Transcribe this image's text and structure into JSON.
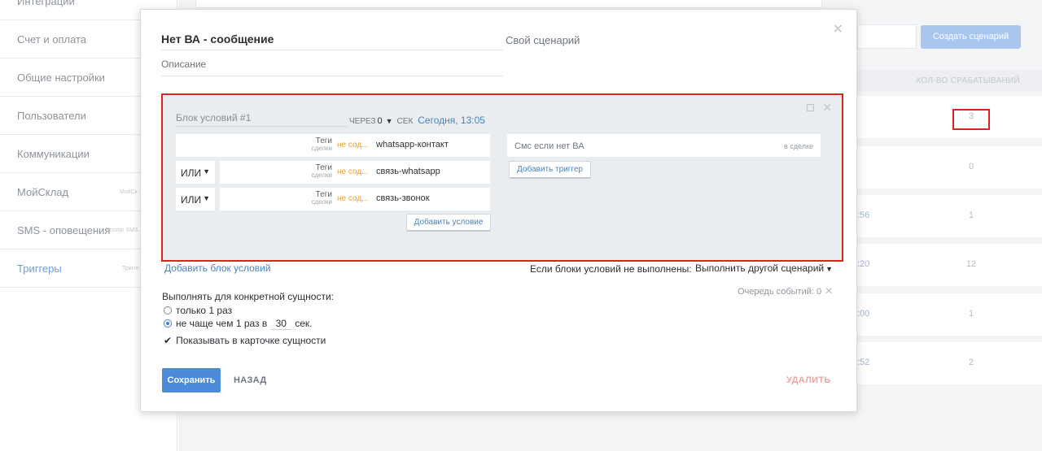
{
  "sidebar": {
    "items": [
      {
        "label": "Интеграции",
        "sub": ""
      },
      {
        "label": "Счет и оплата",
        "sub": ""
      },
      {
        "label": "Общие настройки",
        "sub": ""
      },
      {
        "label": "Пользователи",
        "sub": ""
      },
      {
        "label": "Коммуникации",
        "sub": ""
      },
      {
        "label": "МойСклад",
        "sub": "МойСк"
      },
      {
        "label": "SMS - оповещения",
        "sub": "Prostor SMS"
      },
      {
        "label": "Триггеры",
        "sub": "Тригге"
      }
    ]
  },
  "background": {
    "create_button": "Создать сценарий",
    "column_header": "КОЛ-ВО СРАБАТЫВАНИЙ",
    "rows": [
      {
        "time": "",
        "count": "3"
      },
      {
        "time": "",
        "count": "0"
      },
      {
        "time": ":56",
        "count": "1"
      },
      {
        "time": ":20",
        "count": "12"
      },
      {
        "time": ":00",
        "count": "1"
      },
      {
        "time": ":52",
        "count": "2"
      }
    ]
  },
  "modal": {
    "title": "Нет ВА - сообщение",
    "scenario_type": "Свой сценарий",
    "description_placeholder": "Описание",
    "block": {
      "title": "Блок условий #1",
      "via_label": "ЧЕРЕЗ",
      "via_value": "0",
      "sec_label": "СЕК",
      "date": "Сегодня, 13:05",
      "conditions": [
        {
          "connector": "",
          "field": "Теги",
          "field_sub": "сделки",
          "op": "не сод...",
          "value": "whatsapp-контакт"
        },
        {
          "connector": "ИЛИ",
          "field": "Теги",
          "field_sub": "сделки",
          "op": "не сод...",
          "value": "связь-whatsapp"
        },
        {
          "connector": "ИЛИ",
          "field": "Теги",
          "field_sub": "сделки",
          "op": "не сод...",
          "value": "связь-звонок"
        }
      ],
      "add_condition": "Добавить условие",
      "trigger": {
        "name": "Смс если нет ВА",
        "context": "в сделке"
      },
      "add_trigger": "Добавить триггер"
    },
    "add_block": "Добавить блок условий",
    "else_label": "Если блоки условий не выполнены:",
    "else_value": "Выполнить другой сценарий",
    "queue": "Очередь событий: 0",
    "execution": {
      "title": "Выполнять для конкретной сущности:",
      "once": "только 1 раз",
      "not_more_prefix": "не чаще чем 1 раз в",
      "not_more_value": "30",
      "not_more_suffix": "сек.",
      "show_in_card": "Показывать в карточке сущности"
    },
    "save": "Сохранить",
    "back": "НАЗАД",
    "delete": "УДАЛИТЬ"
  }
}
